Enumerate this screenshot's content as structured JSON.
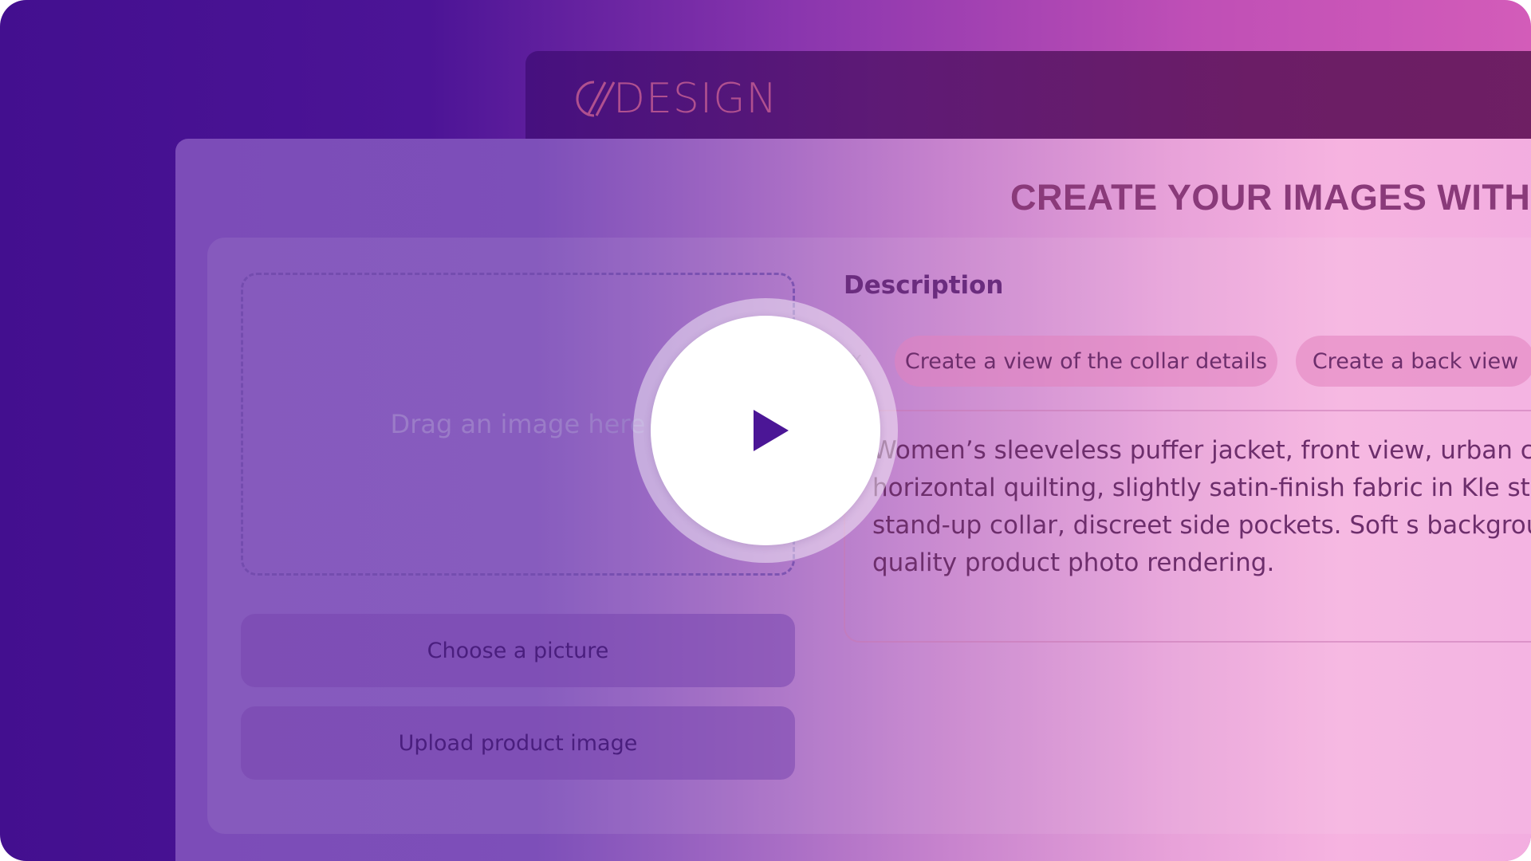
{
  "brand": {
    "logo_text": "DESIGN",
    "logo_color": "#b0508f"
  },
  "main": {
    "title": "CREATE YOUR IMAGES WITH"
  },
  "upload": {
    "dropzone_text": "Drag an image here",
    "choose_label": "Choose a picture",
    "upload_label": "Upload product image"
  },
  "description": {
    "label": "Description",
    "chip_close": "x",
    "suggestions": [
      "Create a view of the collar details",
      "Create a back view"
    ],
    "text": "Women’s sleeveless puffer jacket, front view, urban chic fine horizontal quilting, slightly satin-finish fabric in Kle structured stand-up collar, discreet side pockets. Soft s background, high-quality product photo rendering."
  },
  "video": {
    "play_icon": "play-icon",
    "accent": "#4b1696"
  }
}
